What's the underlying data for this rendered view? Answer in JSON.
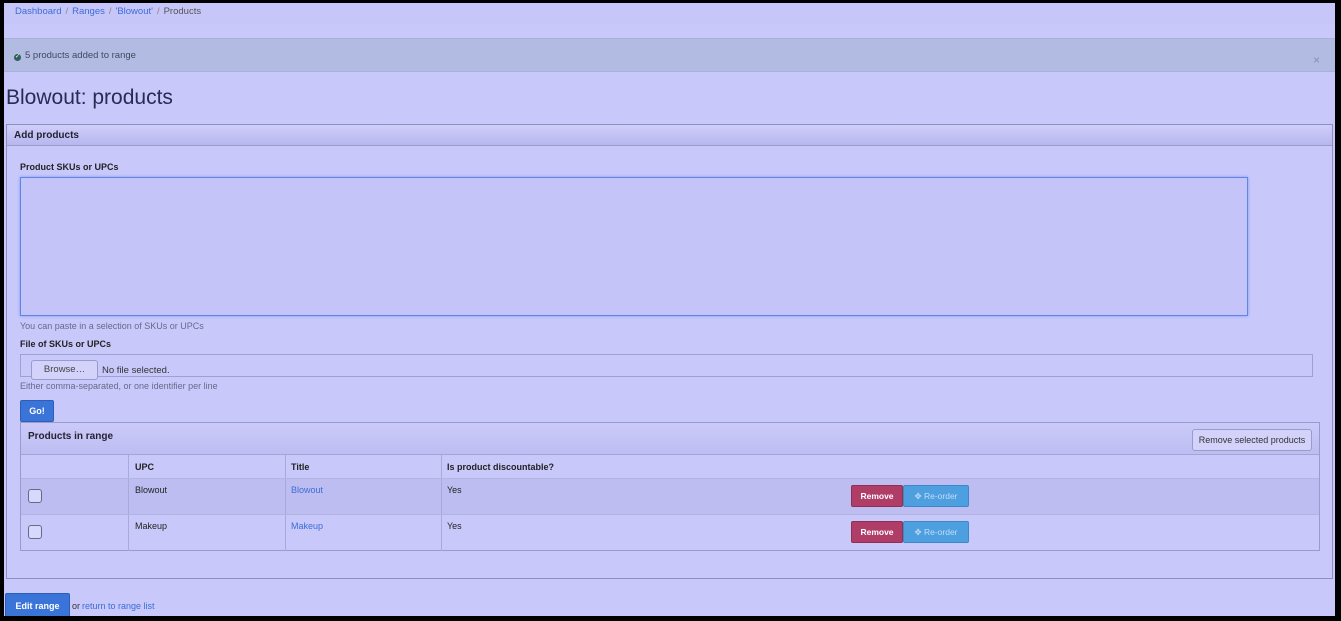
{
  "breadcrumb": {
    "items": [
      "Dashboard",
      "Ranges",
      "'Blowout'",
      "Products"
    ],
    "separator": "/"
  },
  "alert": {
    "message": "5 products added to range",
    "close": "×",
    "icon": "check-circle-icon"
  },
  "page_title": "Blowout: products",
  "add_products": {
    "title": "Add products",
    "skus_label": "Product SKUs or UPCs",
    "skus_value": "",
    "skus_help": "You can paste in a selection of SKUs or UPCs",
    "file_label": "File of SKUs or UPCs",
    "browse_label": "Browse…",
    "file_status": "No file selected.",
    "file_help": "Either comma-separated, or one identifier per line",
    "go_label": "Go!"
  },
  "range": {
    "title": "Products in range",
    "remove_selected_label": "Remove selected products",
    "columns": [
      "UPC",
      "Title",
      "Is product discountable?"
    ],
    "rows": [
      {
        "upc": "Blowout",
        "title": "Blowout",
        "discountable": "Yes",
        "checked": false
      },
      {
        "upc": "Makeup",
        "title": "Makeup",
        "discountable": "Yes",
        "checked": false
      }
    ],
    "remove_label": "Remove",
    "reorder_label": "Re-order",
    "reorder_icon": "move-arrows-icon"
  },
  "footer": {
    "edit_label": "Edit range",
    "or_text": "or",
    "return_label": "return to range list"
  },
  "colors": {
    "background": "#c9c8fb",
    "primary": "#3a74d8",
    "danger": "#b03d68",
    "info": "#4d9fe0",
    "link": "#3a6ed6"
  }
}
